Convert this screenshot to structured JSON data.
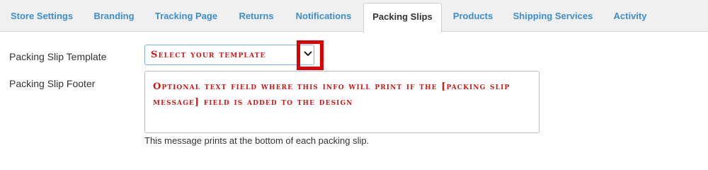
{
  "tabs": [
    {
      "label": "Store Settings",
      "active": false
    },
    {
      "label": "Branding",
      "active": false
    },
    {
      "label": "Tracking Page",
      "active": false
    },
    {
      "label": "Returns",
      "active": false
    },
    {
      "label": "Notifications",
      "active": false
    },
    {
      "label": "Packing Slips",
      "active": true
    },
    {
      "label": "Products",
      "active": false
    },
    {
      "label": "Shipping Services",
      "active": false
    },
    {
      "label": "Activity",
      "active": false
    }
  ],
  "form": {
    "template_label": "Packing Slip Template",
    "template_select_value": "Select your template",
    "footer_label": "Packing Slip Footer",
    "footer_value": "Optional text field where this info will print if the [packing slip message] field is added to the design",
    "footer_help": "This message prints at the bottom of each packing slip."
  },
  "icons": {
    "select_dropdown": "chevron-down-icon"
  },
  "colors": {
    "tab_link": "#3a8fd0",
    "annotation_red": "#d01818",
    "highlight_red": "#dd0000"
  }
}
